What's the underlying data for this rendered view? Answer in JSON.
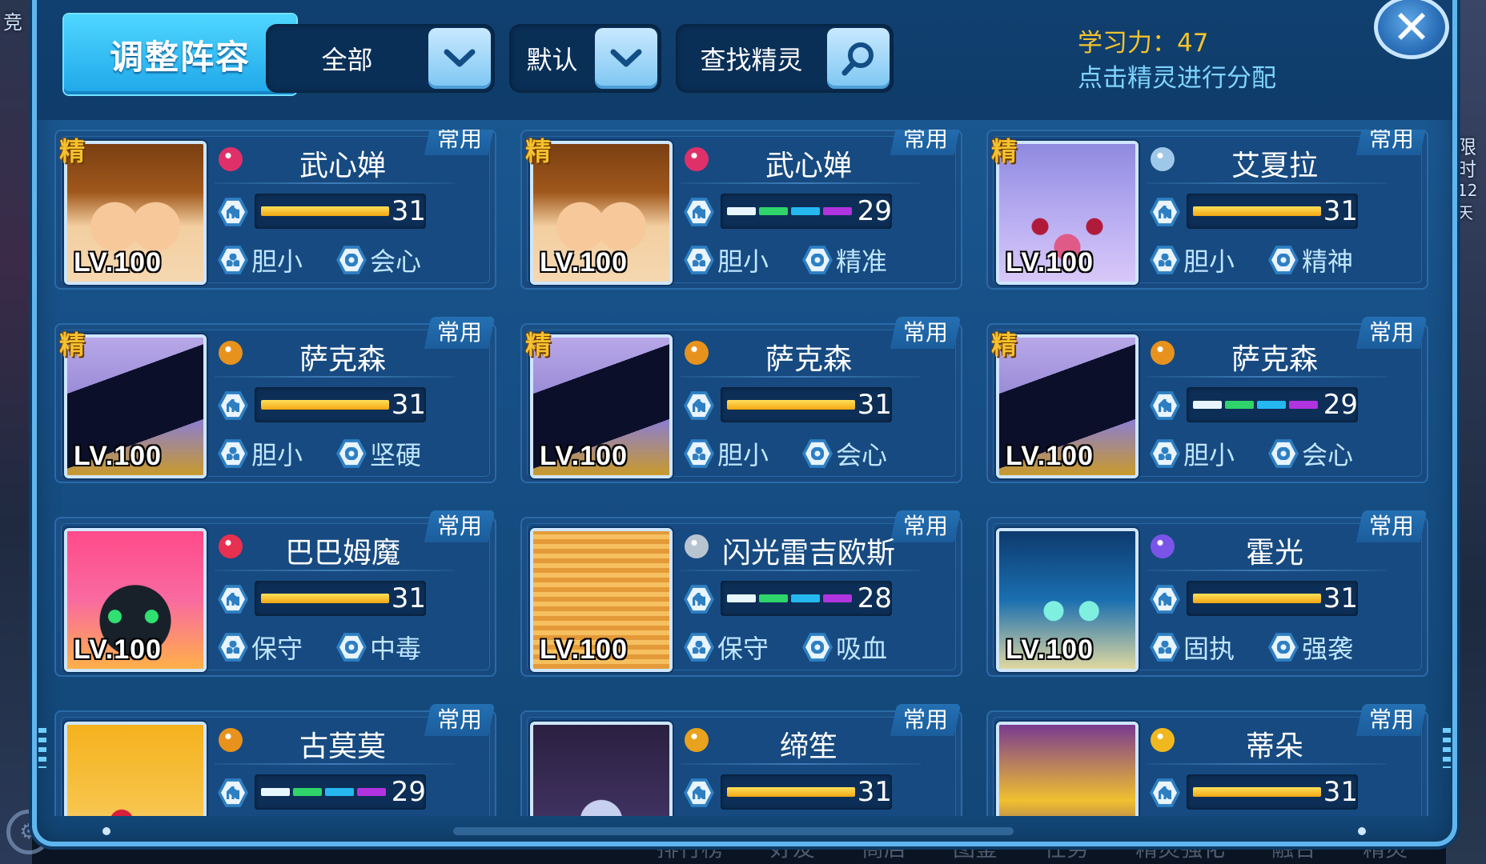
{
  "background": {
    "left_edge_text": "竞",
    "right_edge_text": "限时",
    "right_edge_text2": "12天",
    "bottom_nav": [
      "排行榜",
      "好友",
      "商店",
      "图鉴",
      "任务",
      "精灵强化",
      "融合",
      "精灵"
    ]
  },
  "toolbar": {
    "title": "调整阵容",
    "filter_category": "全部",
    "filter_sort": "默认",
    "search_placeholder": "查找精灵",
    "learn_power_label": "学习力：47",
    "hint": "点击精灵进行分配"
  },
  "cards": [
    {
      "name": "武心婵",
      "tag": "常用",
      "elite": "精",
      "level": "LV.100",
      "stat": "31",
      "stat_type": "gold",
      "nature": "胆小",
      "ability": "会心",
      "elem_color": "#e0306a",
      "art": "a"
    },
    {
      "name": "武心婵",
      "tag": "常用",
      "elite": "精",
      "level": "LV.100",
      "stat": "29",
      "stat_type": "segments",
      "nature": "胆小",
      "ability": "精准",
      "elem_color": "#e0306a",
      "art": "a"
    },
    {
      "name": "艾夏拉",
      "tag": "常用",
      "elite": "精",
      "level": "LV.100",
      "stat": "31",
      "stat_type": "gold",
      "nature": "胆小",
      "ability": "精神",
      "elem_color": "#9fc8e8",
      "art": "b"
    },
    {
      "name": "萨克森",
      "tag": "常用",
      "elite": "精",
      "level": "LV.100",
      "stat": "31",
      "stat_type": "gold",
      "nature": "胆小",
      "ability": "坚硬",
      "elem_color": "#e8921e",
      "art": "c"
    },
    {
      "name": "萨克森",
      "tag": "常用",
      "elite": "精",
      "level": "LV.100",
      "stat": "31",
      "stat_type": "gold",
      "nature": "胆小",
      "ability": "会心",
      "elem_color": "#e8921e",
      "art": "c"
    },
    {
      "name": "萨克森",
      "tag": "常用",
      "elite": "精",
      "level": "LV.100",
      "stat": "29",
      "stat_type": "segments",
      "nature": "胆小",
      "ability": "会心",
      "elem_color": "#e8921e",
      "art": "c"
    },
    {
      "name": "巴巴姆魔",
      "tag": "常用",
      "elite": "",
      "level": "LV.100",
      "stat": "31",
      "stat_type": "gold",
      "nature": "保守",
      "ability": "中毒",
      "elem_color": "#e83050",
      "art": "d"
    },
    {
      "name": "闪光雷吉欧斯",
      "tag": "常用",
      "elite": "",
      "level": "LV.100",
      "stat": "28",
      "stat_type": "segments",
      "nature": "保守",
      "ability": "吸血",
      "elem_color": "#b8c4d0",
      "art": "e"
    },
    {
      "name": "霍光",
      "tag": "常用",
      "elite": "",
      "level": "LV.100",
      "stat": "31",
      "stat_type": "gold",
      "nature": "固执",
      "ability": "强袭",
      "elem_color": "#7a54e8",
      "art": "f"
    },
    {
      "name": "古莫莫",
      "tag": "常用",
      "elite": "",
      "level": "",
      "stat": "29",
      "stat_type": "segments",
      "nature": "",
      "ability": "",
      "elem_color": "#e8921e",
      "art": "g"
    },
    {
      "name": "缔笙",
      "tag": "常用",
      "elite": "",
      "level": "",
      "stat": "31",
      "stat_type": "gold",
      "nature": "",
      "ability": "",
      "elem_color": "#e8a21e",
      "art": "h"
    },
    {
      "name": "蒂朵",
      "tag": "常用",
      "elite": "",
      "level": "",
      "stat": "31",
      "stat_type": "gold",
      "nature": "",
      "ability": "",
      "elem_color": "#f0b81e",
      "art": "i"
    }
  ],
  "colors": {
    "gold": "#f4c22d",
    "hint": "#7fd4ff",
    "seg_white": "#e8f6ff",
    "seg_green": "#2fd46a",
    "seg_cyan": "#25b8f0",
    "seg_purple": "#b233e0"
  }
}
